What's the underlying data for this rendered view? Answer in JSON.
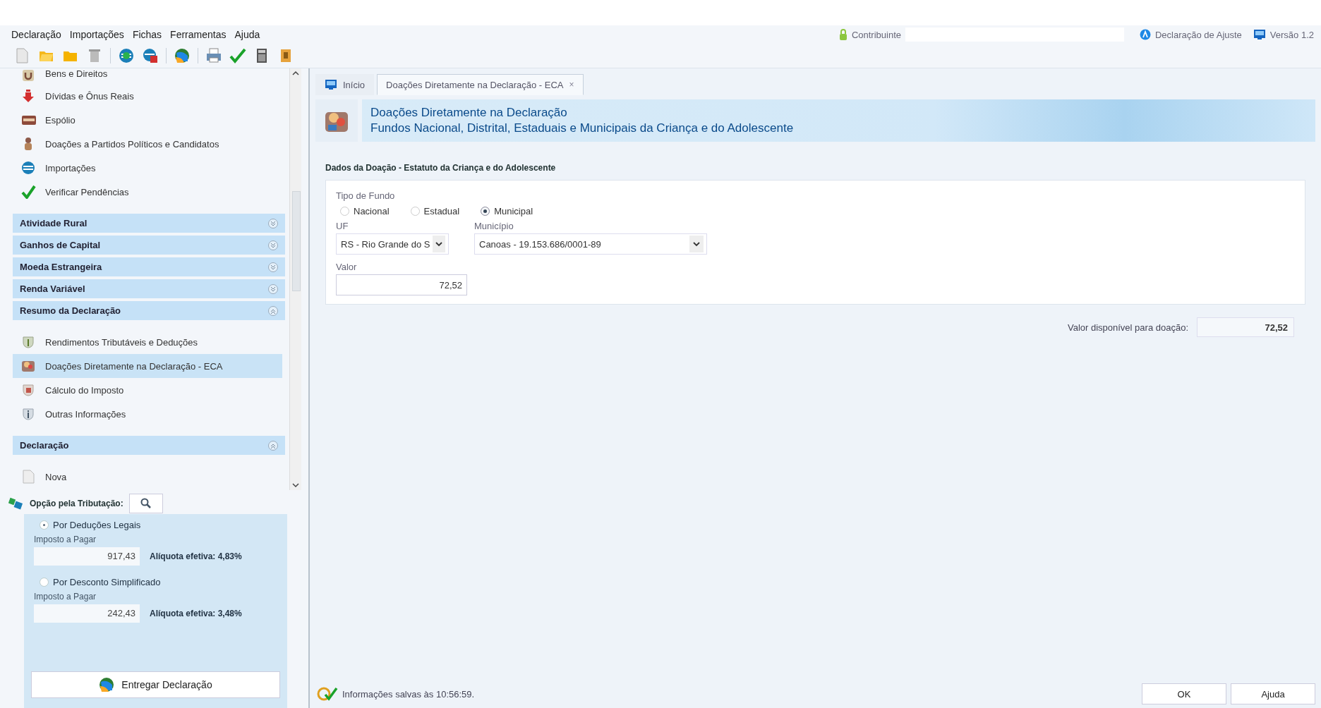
{
  "menu": [
    {
      "label": "Declaração"
    },
    {
      "label": "Importações"
    },
    {
      "label": "Fichas"
    },
    {
      "label": "Ferramentas"
    },
    {
      "label": "Ajuda"
    }
  ],
  "header_info": {
    "contribuinte_label": "Contribuinte",
    "declaration_type": "Declaração de Ajuste",
    "version": "Versão 1.2"
  },
  "sidebar": {
    "items": [
      {
        "kind": "item",
        "label": "Bens e Direitos",
        "selected": false
      },
      {
        "kind": "item",
        "label": "Dívidas e Ônus Reais",
        "selected": false
      },
      {
        "kind": "item",
        "label": "Espólio",
        "selected": false
      },
      {
        "kind": "item",
        "label": "Doações a Partidos Políticos e Candidatos",
        "selected": false
      },
      {
        "kind": "item",
        "label": "Importações",
        "selected": false
      },
      {
        "kind": "item",
        "label": "Verificar Pendências",
        "selected": false
      },
      {
        "kind": "group",
        "label": "Atividade Rural",
        "expanded": false
      },
      {
        "kind": "group",
        "label": "Ganhos de Capital",
        "expanded": false
      },
      {
        "kind": "group",
        "label": "Moeda Estrangeira",
        "expanded": false
      },
      {
        "kind": "group",
        "label": "Renda Variável",
        "expanded": false
      },
      {
        "kind": "group",
        "label": "Resumo da Declaração",
        "expanded": true
      },
      {
        "kind": "item",
        "label": "Rendimentos Tributáveis e Deduções",
        "selected": false
      },
      {
        "kind": "item",
        "label": "Doações Diretamente na Declaração - ECA",
        "selected": true
      },
      {
        "kind": "item",
        "label": "Cálculo do Imposto",
        "selected": false
      },
      {
        "kind": "item",
        "label": "Outras Informações",
        "selected": false
      },
      {
        "kind": "group",
        "label": "Declaração",
        "expanded": true
      },
      {
        "kind": "item",
        "label": "Nova",
        "selected": false
      }
    ]
  },
  "tax_option": {
    "title": "Opção pela Tributação:",
    "options": [
      {
        "label": "Por Deduções Legais",
        "selected": true,
        "field_label": "Imposto a Pagar",
        "value": "917,43",
        "rate": "Alíquota efetiva: 4,83%"
      },
      {
        "label": "Por Desconto Simplificado",
        "selected": false,
        "field_label": "Imposto a Pagar",
        "value": "242,43",
        "rate": "Alíquota efetiva: 3,48%"
      }
    ],
    "submit": "Entregar Declaração"
  },
  "tabs": [
    {
      "label": "Início",
      "selected": false
    },
    {
      "label": "Doações Diretamente na Declaração - ECA",
      "selected": true,
      "close": "×"
    }
  ],
  "banner": {
    "title": "Doações Diretamente na Declaração",
    "subtitle": "Fundos Nacional, Distrital, Estaduais e Municipais da Criança e do Adolescente"
  },
  "form": {
    "section_title": "Dados da Doação - Estatuto da Criança e do Adolescente",
    "fund_type_label": "Tipo de Fundo",
    "fund_types": [
      {
        "label": "Nacional",
        "selected": false
      },
      {
        "label": "Estadual",
        "selected": false
      },
      {
        "label": "Municipal",
        "selected": true
      }
    ],
    "uf_label": "UF",
    "uf_value": "RS - Rio Grande do S",
    "municipio_label": "Município",
    "municipio_value": "Canoas - 19.153.686/0001-89",
    "valor_label": "Valor",
    "valor_value": "72,52"
  },
  "available": {
    "label": "Valor disponível para doação:",
    "value": "72,52"
  },
  "status": "Informações salvas às 10:56:59.",
  "buttons": [
    "OK",
    "Ajuda"
  ]
}
